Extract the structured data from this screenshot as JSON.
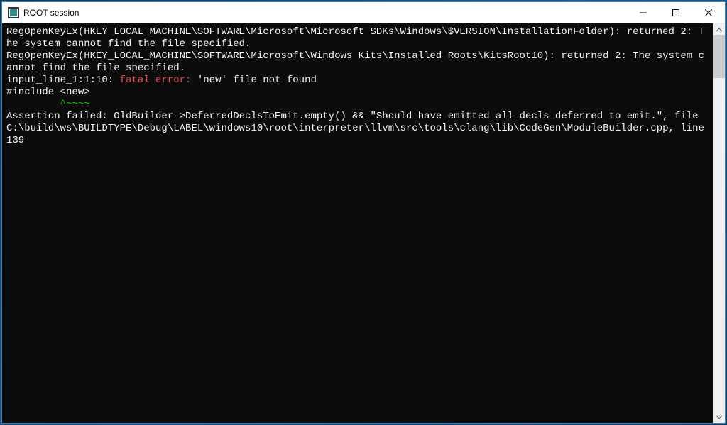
{
  "window": {
    "title": "ROOT session"
  },
  "console": {
    "lines": [
      {
        "text": "RegOpenKeyEx(HKEY_LOCAL_MACHINE\\SOFTWARE\\Microsoft\\Microsoft SDKs\\Windows\\$VERSION\\InstallationFolder): returned 2: The system cannot find the file specified.",
        "color": "white"
      },
      {
        "text": "RegOpenKeyEx(HKEY_LOCAL_MACHINE\\SOFTWARE\\Microsoft\\Windows Kits\\Installed Roots\\KitsRoot10): returned 2: The system cannot find the file specified.",
        "color": "white"
      }
    ],
    "error_line": {
      "prefix": "input_line_1:1:10: ",
      "error_label": "fatal error: ",
      "message": "'new' file not found"
    },
    "include_line": "#include <new>",
    "caret_line": "         ^~~~~",
    "assertion": [
      "Assertion failed: OldBuilder->DeferredDeclsToEmit.empty() && \"Should have emitted all decls deferred to emit.\", file C:\\build\\ws\\BUILDTYPE\\Debug\\LABEL\\windows10\\root\\interpreter\\llvm\\src\\tools\\clang\\lib\\CodeGen\\ModuleBuilder.cpp, line 139"
    ]
  }
}
